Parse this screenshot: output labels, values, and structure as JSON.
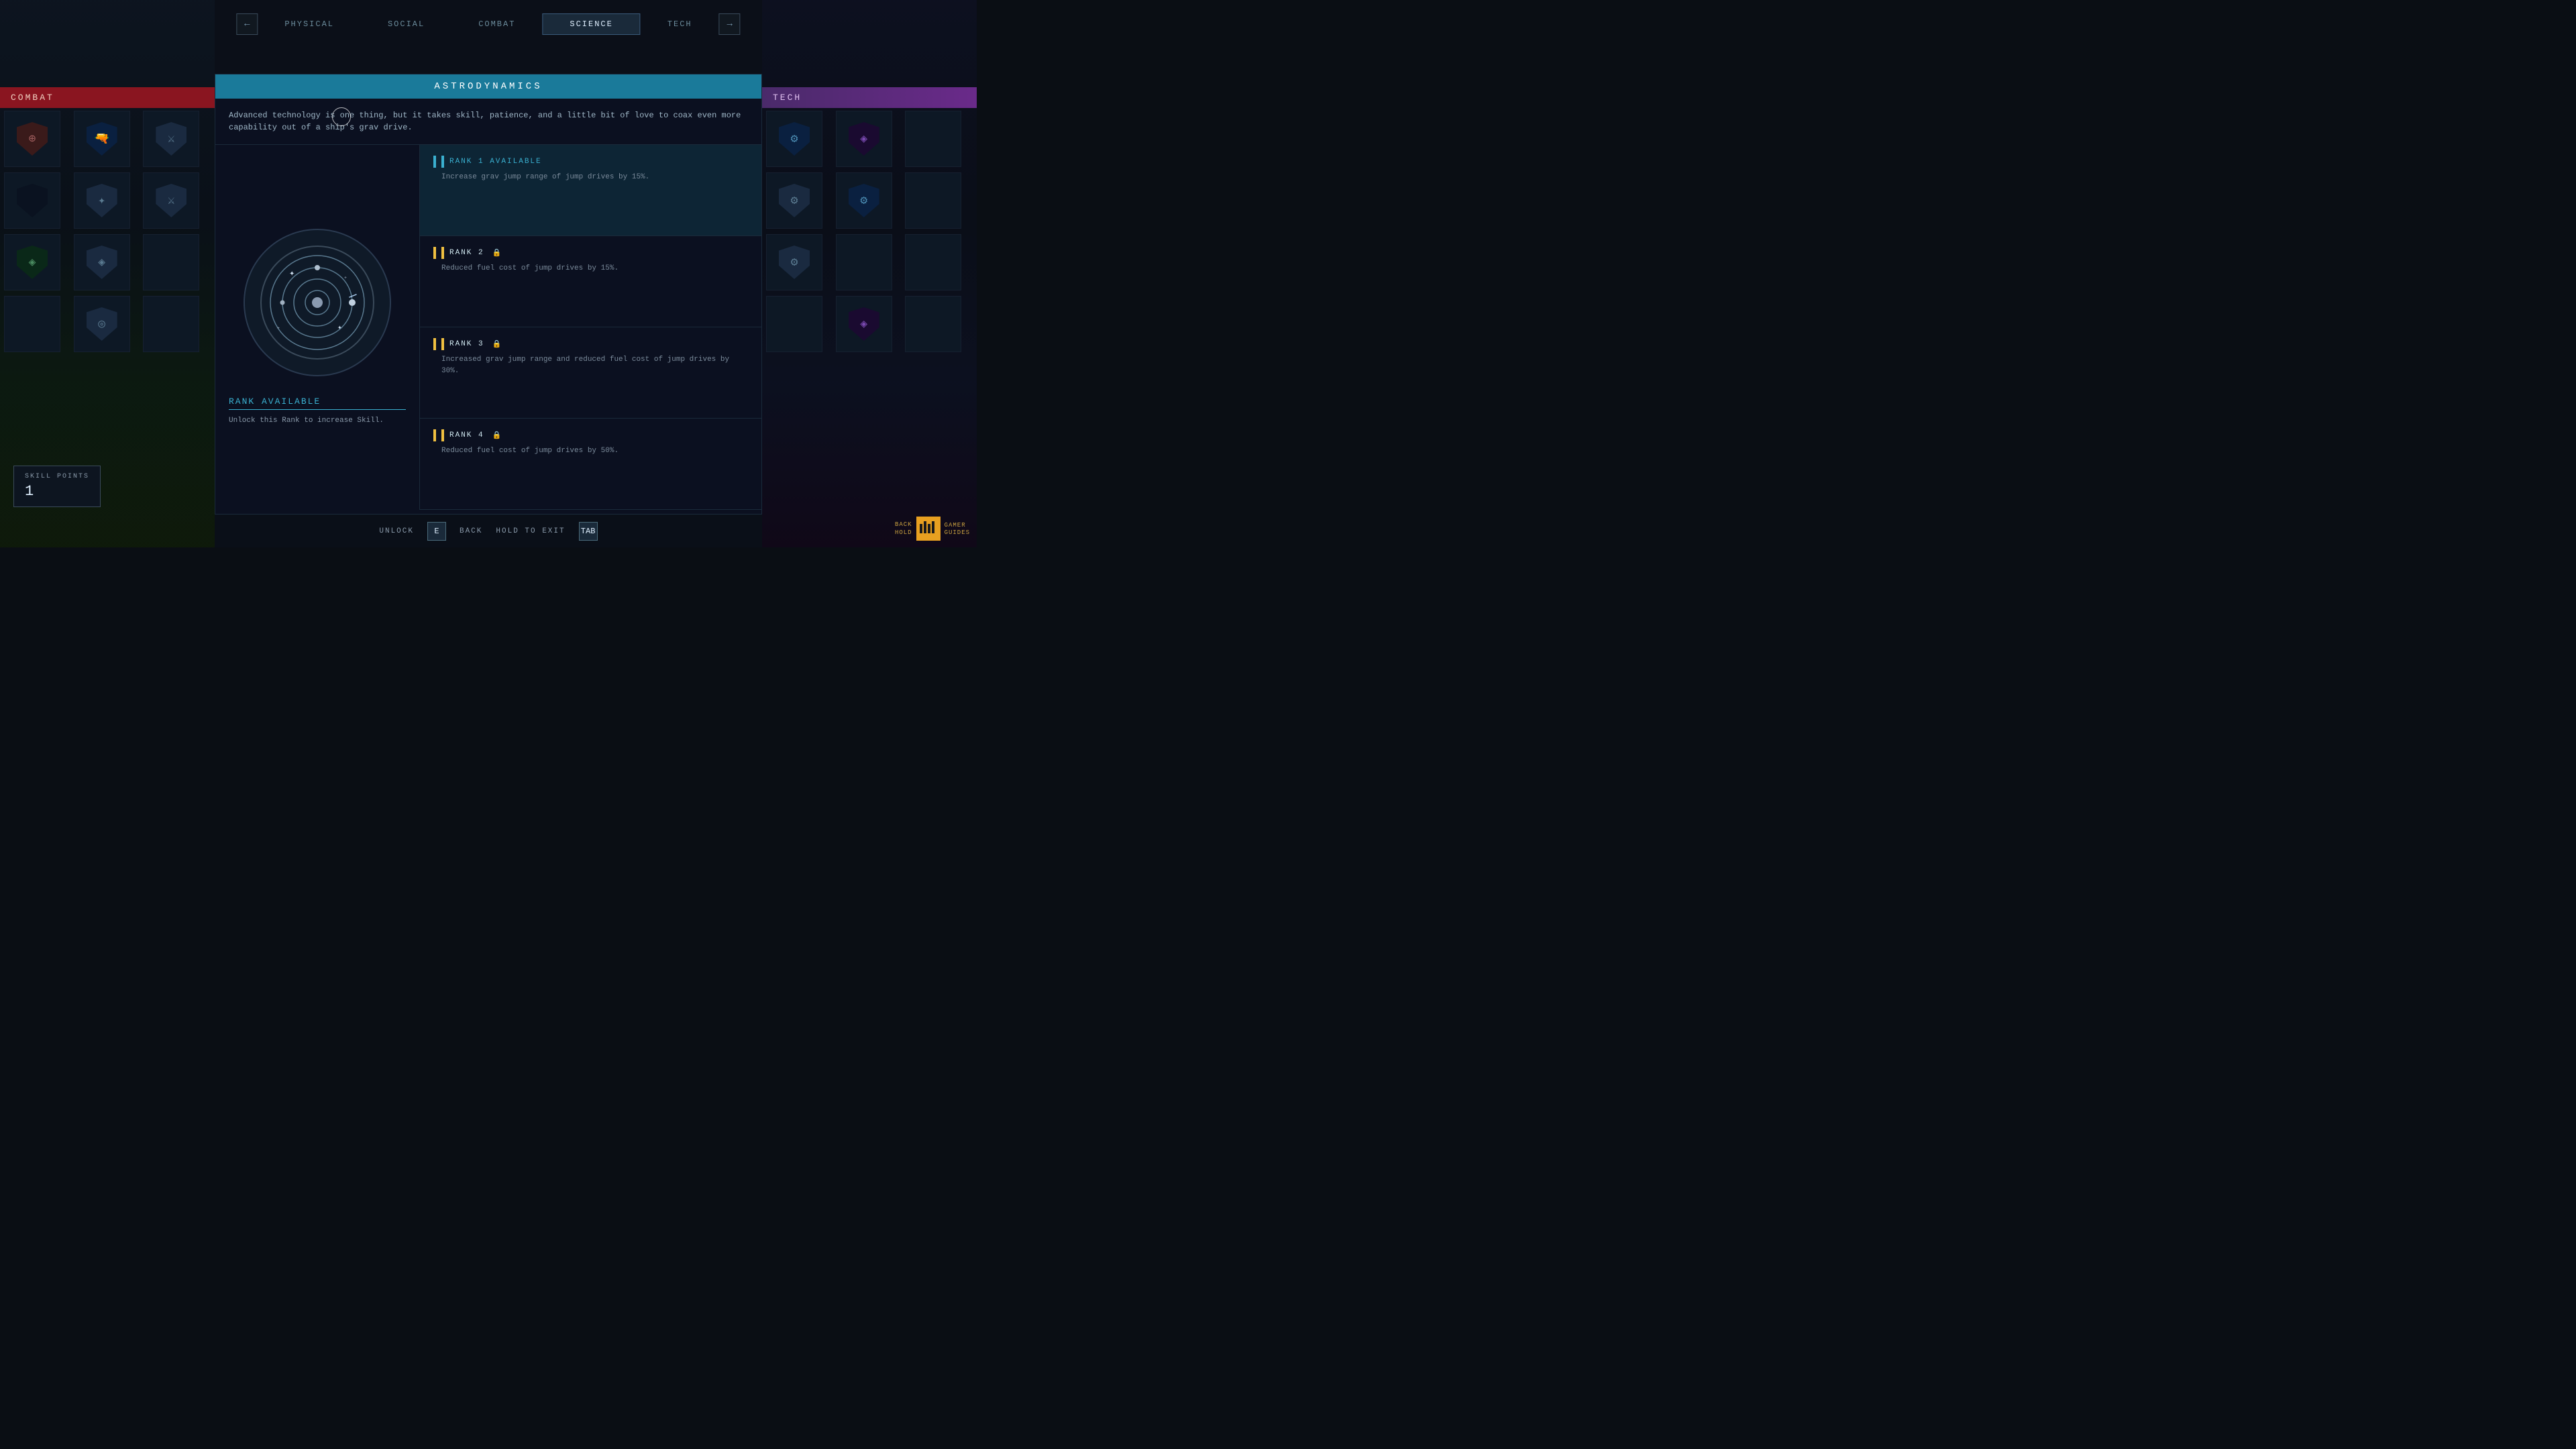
{
  "nav": {
    "prev_arrow": "←",
    "next_arrow": "→",
    "tabs": [
      {
        "id": "physical",
        "label": "PHYSICAL",
        "active": false
      },
      {
        "id": "social",
        "label": "SOCIAL",
        "active": false
      },
      {
        "id": "combat",
        "label": "COMBAT",
        "active": false
      },
      {
        "id": "science",
        "label": "SCIENCE",
        "active": true
      },
      {
        "id": "tech",
        "label": "TECH",
        "active": false
      }
    ]
  },
  "left_panel": {
    "header": "COMBAT"
  },
  "right_panel": {
    "header": "TECH"
  },
  "skill": {
    "title": "ASTRODYNAMICS",
    "description": "Advanced technology is one thing, but it takes skill, patience, and a little bit of love to coax even more capability out of a ship's grav drive.",
    "rank_available_label": "RANK AVAILABLE",
    "rank_available_desc": "Unlock this Rank to increase Skill.",
    "ranks": [
      {
        "id": 1,
        "label": "RANK 1 AVAILABLE",
        "desc": "Increase grav jump range of jump drives by 15%.",
        "available": true,
        "locked": false
      },
      {
        "id": 2,
        "label": "RANK 2",
        "desc": "Reduced fuel cost of jump drives by 15%.",
        "available": false,
        "locked": true
      },
      {
        "id": 3,
        "label": "RANK 3",
        "desc": "Increased grav jump range and reduced fuel cost of jump drives by 30%.",
        "available": false,
        "locked": true
      },
      {
        "id": 4,
        "label": "RANK 4",
        "desc": "Reduced fuel cost of jump drives by 50%.",
        "available": false,
        "locked": true
      }
    ]
  },
  "bottom_bar": {
    "unlock_label": "UNLOCK",
    "unlock_key": "E",
    "back_label": "BACK",
    "back_action": "HOLD TO EXIT",
    "back_key": "TAB"
  },
  "skill_points": {
    "label": "SKILL POINTS",
    "value": "1"
  },
  "icons": {
    "lock": "🔒",
    "pip_char": "▐"
  }
}
